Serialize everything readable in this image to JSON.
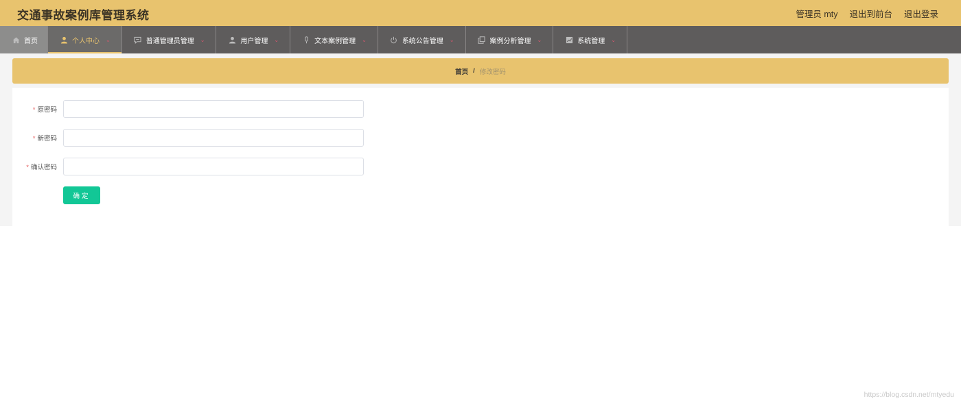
{
  "header": {
    "title": "交通事故案例库管理系统",
    "user": "管理员 mty",
    "exit_frontend": "退出到前台",
    "logout": "退出登录"
  },
  "nav": {
    "items": [
      {
        "label": "首页",
        "icon": "home-icon"
      },
      {
        "label": "个人中心",
        "icon": "user-icon"
      },
      {
        "label": "普通管理员管理",
        "icon": "chat-icon"
      },
      {
        "label": "用户管理",
        "icon": "person-icon"
      },
      {
        "label": "文本案例管理",
        "icon": "microphone-icon"
      },
      {
        "label": "系统公告管理",
        "icon": "power-icon"
      },
      {
        "label": "案例分析管理",
        "icon": "copy-icon"
      },
      {
        "label": "系统管理",
        "icon": "chart-icon"
      }
    ]
  },
  "breadcrumb": {
    "home": "首页",
    "separator": "/",
    "current": "修改密码"
  },
  "form": {
    "old_password_label": "原密码",
    "new_password_label": "新密码",
    "confirm_password_label": "确认密码",
    "required_mark": "*",
    "old_password_value": "",
    "new_password_value": "",
    "confirm_password_value": "",
    "submit_label": "确定"
  },
  "watermark": "https://blog.csdn.net/mtyedu",
  "colors": {
    "header_bg": "#e8c36e",
    "nav_bg": "#5e5c5c",
    "accent_green": "#12c796",
    "required_red": "#e55b5b"
  }
}
